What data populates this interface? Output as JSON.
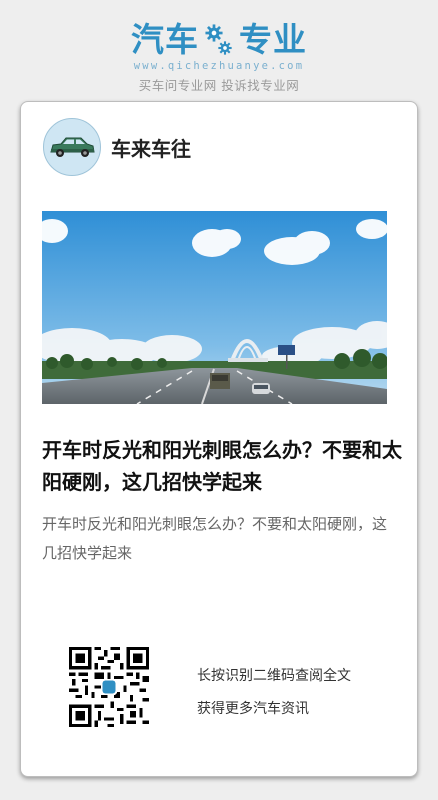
{
  "header": {
    "logo_left": "汽车",
    "logo_right": "专业",
    "logo_icon": "gear-icon",
    "domain": "www.qichezhuanye.com",
    "tagline": "买车问专业网 投诉找专业网",
    "brand_color": "#2f8fc3"
  },
  "card": {
    "author": {
      "name": "车来车往",
      "avatar_icon": "car-icon"
    },
    "hero_image": "highway-bridge-sky-photo",
    "title": "开车时反光和阳光刺眼怎么办？不要和太阳硬刚，这几招快学起来",
    "summary": "开车时反光和阳光刺眼怎么办？不要和太阳硬刚，这几招快学起来",
    "qr": {
      "icon": "qr-code",
      "line1": "长按识别二维码查阅全文",
      "line2": "获得更多汽车资讯"
    }
  }
}
